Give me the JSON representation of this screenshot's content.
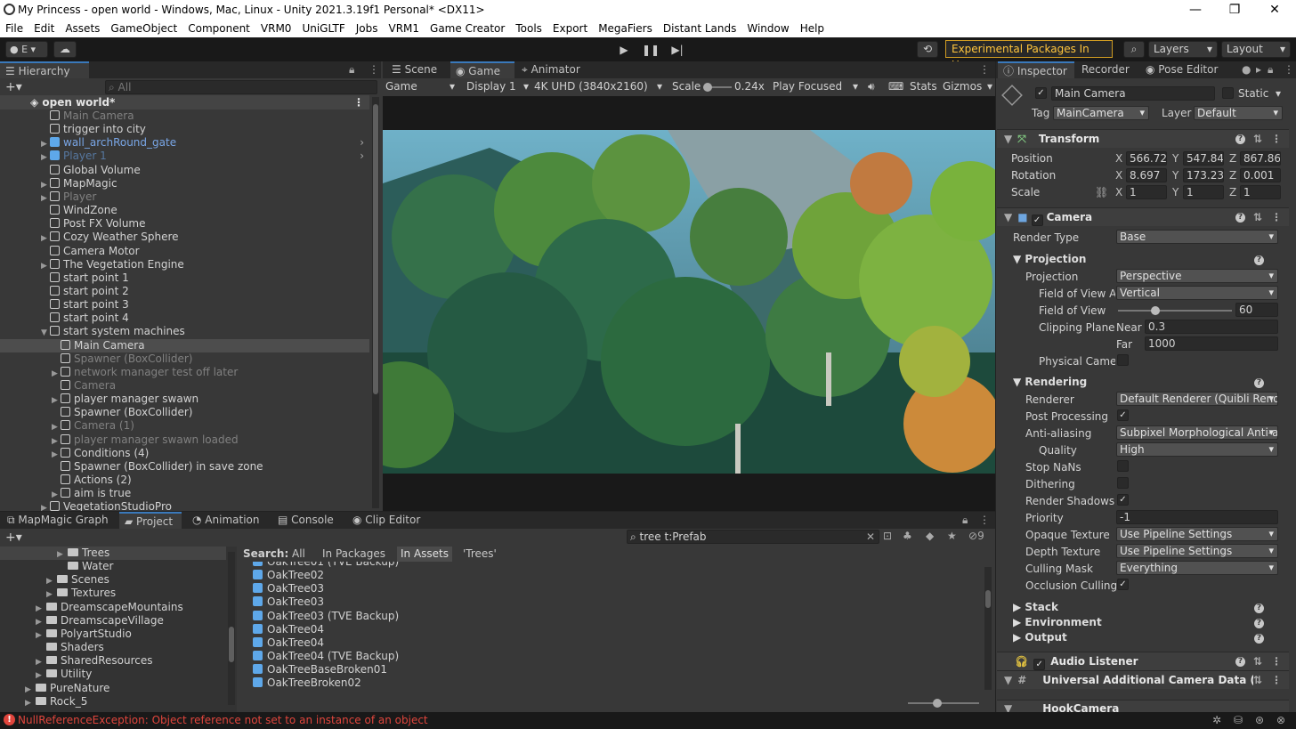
{
  "window": {
    "title": "My Princess - open world - Windows, Mac, Linux - Unity 2021.3.19f1 Personal* <DX11>",
    "min": "—",
    "max": "❐",
    "close": "✕"
  },
  "menu": [
    "File",
    "Edit",
    "Assets",
    "GameObject",
    "Component",
    "VRM0",
    "UniGLTF",
    "Jobs",
    "VRM1",
    "Game Creator",
    "Tools",
    "Export",
    "MegaFiers",
    "Distant Lands",
    "Window",
    "Help"
  ],
  "toolbar": {
    "account": "E",
    "experimental": "Experimental Packages In Use",
    "layers": "Layers",
    "layout": "Layout"
  },
  "hierarchy": {
    "tab": "Hierarchy",
    "search_placeholder": "All",
    "scene": "open world*",
    "items": [
      {
        "label": "Main Camera",
        "state": "dim",
        "indent": 0,
        "arrow": ""
      },
      {
        "label": "trigger into city",
        "state": "",
        "indent": 0,
        "arrow": ""
      },
      {
        "label": "wall_archRound_gate",
        "state": "blue",
        "indent": 0,
        "arrow": "▶"
      },
      {
        "label": "Player 1",
        "state": "bluedim",
        "indent": 0,
        "arrow": "▶"
      },
      {
        "label": "Global Volume",
        "state": "",
        "indent": 0,
        "arrow": ""
      },
      {
        "label": "MapMagic",
        "state": "",
        "indent": 0,
        "arrow": "▶"
      },
      {
        "label": "Player",
        "state": "dim",
        "indent": 0,
        "arrow": "▶"
      },
      {
        "label": "WindZone",
        "state": "",
        "indent": 0,
        "arrow": ""
      },
      {
        "label": "Post FX Volume",
        "state": "",
        "indent": 0,
        "arrow": ""
      },
      {
        "label": "Cozy Weather Sphere",
        "state": "",
        "indent": 0,
        "arrow": "▶"
      },
      {
        "label": "Camera Motor",
        "state": "",
        "indent": 0,
        "arrow": ""
      },
      {
        "label": "The Vegetation Engine",
        "state": "",
        "indent": 0,
        "arrow": "▶"
      },
      {
        "label": "start point 1",
        "state": "",
        "indent": 0,
        "arrow": ""
      },
      {
        "label": "start point 2",
        "state": "",
        "indent": 0,
        "arrow": ""
      },
      {
        "label": "start point 3",
        "state": "",
        "indent": 0,
        "arrow": ""
      },
      {
        "label": "start point 4",
        "state": "",
        "indent": 0,
        "arrow": ""
      },
      {
        "label": "start system machines",
        "state": "",
        "indent": 0,
        "arrow": "▼"
      },
      {
        "label": "Main Camera",
        "state": "selected",
        "indent": 1,
        "arrow": ""
      },
      {
        "label": "Spawner (BoxCollider)",
        "state": "dim",
        "indent": 1,
        "arrow": ""
      },
      {
        "label": "network manager test off later",
        "state": "dim",
        "indent": 1,
        "arrow": "▶"
      },
      {
        "label": "Camera",
        "state": "dim",
        "indent": 1,
        "arrow": ""
      },
      {
        "label": "player manager swawn",
        "state": "",
        "indent": 1,
        "arrow": "▶"
      },
      {
        "label": "Spawner (BoxCollider)",
        "state": "",
        "indent": 1,
        "arrow": ""
      },
      {
        "label": "Camera (1)",
        "state": "dim",
        "indent": 1,
        "arrow": "▶"
      },
      {
        "label": "player manager swawn loaded",
        "state": "dim",
        "indent": 1,
        "arrow": "▶"
      },
      {
        "label": "Conditions (4)",
        "state": "",
        "indent": 1,
        "arrow": "▶"
      },
      {
        "label": "Spawner (BoxCollider) in save zone",
        "state": "",
        "indent": 1,
        "arrow": ""
      },
      {
        "label": "Actions (2)",
        "state": "",
        "indent": 1,
        "arrow": ""
      },
      {
        "label": "aim is true",
        "state": "",
        "indent": 1,
        "arrow": "▶"
      },
      {
        "label": "VegetationStudioPro",
        "state": "",
        "indent": 0,
        "arrow": "▶"
      }
    ]
  },
  "game": {
    "tabs": [
      "Scene",
      "Game",
      "Animator"
    ],
    "mode": "Game",
    "display": "Display 1",
    "resolution": "4K UHD (3840x2160)",
    "scale_label": "Scale",
    "scale_value": "0.24x",
    "play": "Play Focused",
    "stats": "Stats",
    "gizmos": "Gizmos"
  },
  "bottom": {
    "tabs": [
      "MapMagic Graph",
      "Project",
      "Animation",
      "Console",
      "Clip Editor"
    ],
    "search": "tree t:Prefab",
    "hidden_count": "9",
    "search_label": "Search:",
    "filters": [
      "All",
      "In Packages",
      "In Assets",
      "'Trees'"
    ],
    "tree": [
      {
        "label": "Trees",
        "indent": 3,
        "arrow": "▶"
      },
      {
        "label": "Water",
        "indent": 3,
        "arrow": ""
      },
      {
        "label": "Scenes",
        "indent": 2,
        "arrow": "▶"
      },
      {
        "label": "Textures",
        "indent": 2,
        "arrow": "▶"
      },
      {
        "label": "DreamscapeMountains",
        "indent": 1,
        "arrow": "▶"
      },
      {
        "label": "DreamscapeVillage",
        "indent": 1,
        "arrow": "▶"
      },
      {
        "label": "PolyartStudio",
        "indent": 1,
        "arrow": "▶"
      },
      {
        "label": "Shaders",
        "indent": 1,
        "arrow": ""
      },
      {
        "label": "SharedResources",
        "indent": 1,
        "arrow": "▶"
      },
      {
        "label": "Utility",
        "indent": 1,
        "arrow": "▶"
      },
      {
        "label": "PureNature",
        "indent": 0,
        "arrow": "▶"
      },
      {
        "label": "Rock_5",
        "indent": 0,
        "arrow": "▶"
      }
    ],
    "results": [
      "OakTree01 (TVE Backup)",
      "OakTree02",
      "OakTree03",
      "OakTree03",
      "OakTree03 (TVE Backup)",
      "OakTree04",
      "OakTree04",
      "OakTree04 (TVE Backup)",
      "OakTreeBaseBroken01",
      "OakTreeBroken02"
    ]
  },
  "status": {
    "error": "NullReferenceException: Object reference not set to an instance of an object"
  },
  "inspector": {
    "tabs": [
      "Inspector",
      "Recorder",
      "Pose Editor"
    ],
    "name": "Main Camera",
    "static": "Static",
    "tag_label": "Tag",
    "tag": "MainCamera",
    "layer_label": "Layer",
    "layer": "Default",
    "transform": {
      "title": "Transform",
      "position_label": "Position",
      "rotation_label": "Rotation",
      "scale_label": "Scale",
      "pos": [
        "566.720",
        "547.847",
        "867.861"
      ],
      "rot": [
        "8.697",
        "173.234",
        "0.001"
      ],
      "scl": [
        "1",
        "1",
        "1"
      ]
    },
    "camera": {
      "title": "Camera",
      "render_type_label": "Render Type",
      "render_type": "Base",
      "projection_head": "Projection",
      "projection_label": "Projection",
      "projection": "Perspective",
      "fov_axis_label": "Field of View Ax",
      "fov_axis": "Vertical",
      "fov_label": "Field of View",
      "fov": "60",
      "fov_fraction": 0.33,
      "clip_label": "Clipping Planes",
      "near_label": "Near",
      "near": "0.3",
      "far_label": "Far",
      "far": "1000",
      "physical_label": "Physical Camer",
      "rendering_head": "Rendering",
      "renderer_label": "Renderer",
      "renderer": "Default Renderer (Quibli Render",
      "post_label": "Post Processing",
      "aa_label": "Anti-aliasing",
      "aa": "Subpixel Morphological Anti-a",
      "quality_label": "Quality",
      "quality": "High",
      "stopnan_label": "Stop NaNs",
      "dither_label": "Dithering",
      "shadows_label": "Render Shadows",
      "priority_label": "Priority",
      "priority": "-1",
      "opaque_label": "Opaque Texture",
      "opaque": "Use Pipeline Settings",
      "depth_label": "Depth Texture",
      "depth": "Use Pipeline Settings",
      "culling_label": "Culling Mask",
      "culling": "Everything",
      "occlusion_label": "Occlusion Culling",
      "stack": "Stack",
      "environment": "Environment",
      "output": "Output"
    },
    "audio": "Audio Listener",
    "uacd": "Universal Additional Camera Data (S",
    "hook": "HookCamera"
  },
  "colors": {
    "accent": "#3a79bb",
    "warning": "#ffc53d",
    "error": "#e0453c"
  }
}
